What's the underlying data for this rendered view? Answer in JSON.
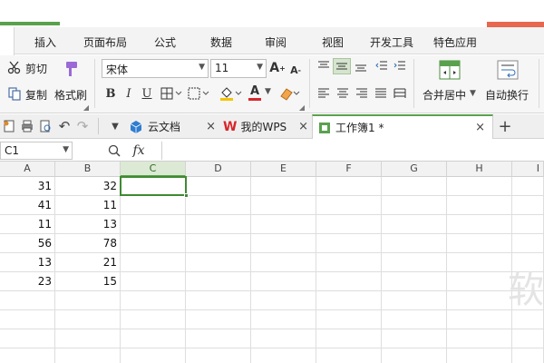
{
  "ribbon_tabs": [
    "插入",
    "页面布局",
    "公式",
    "数据",
    "审阅",
    "视图",
    "开发工具",
    "特色应用"
  ],
  "clipboard": {
    "cut": "剪切",
    "copy": "复制",
    "format_painter": "格式刷"
  },
  "font": {
    "name": "宋体",
    "size": "11"
  },
  "formatting": {
    "bold": "B",
    "italic": "I",
    "underline": "U",
    "font_grow": "A",
    "font_shrink": "A",
    "font_color": "A"
  },
  "alignment": {
    "merge_center": "合并居中",
    "wrap_text": "自动换行"
  },
  "file_tabs": {
    "cloud_docs": "云文档",
    "my_wps": "我的WPS",
    "workbook": "工作簿1 *",
    "close": "×",
    "new_tab": "+"
  },
  "formula_bar": {
    "name_box": "C1",
    "fx": "fx"
  },
  "columns": [
    "A",
    "B",
    "C",
    "D",
    "E",
    "F",
    "G",
    "H",
    "I"
  ],
  "selected_column": "C",
  "rows": [
    [
      "31",
      "32"
    ],
    [
      "41",
      "11"
    ],
    [
      "11",
      "13"
    ],
    [
      "56",
      "78"
    ],
    [
      "13",
      "21"
    ],
    [
      "23",
      "15"
    ]
  ],
  "watermark": "软",
  "colors": {
    "accent_green": "#5aa14e",
    "accent_red": "#e7674f"
  }
}
